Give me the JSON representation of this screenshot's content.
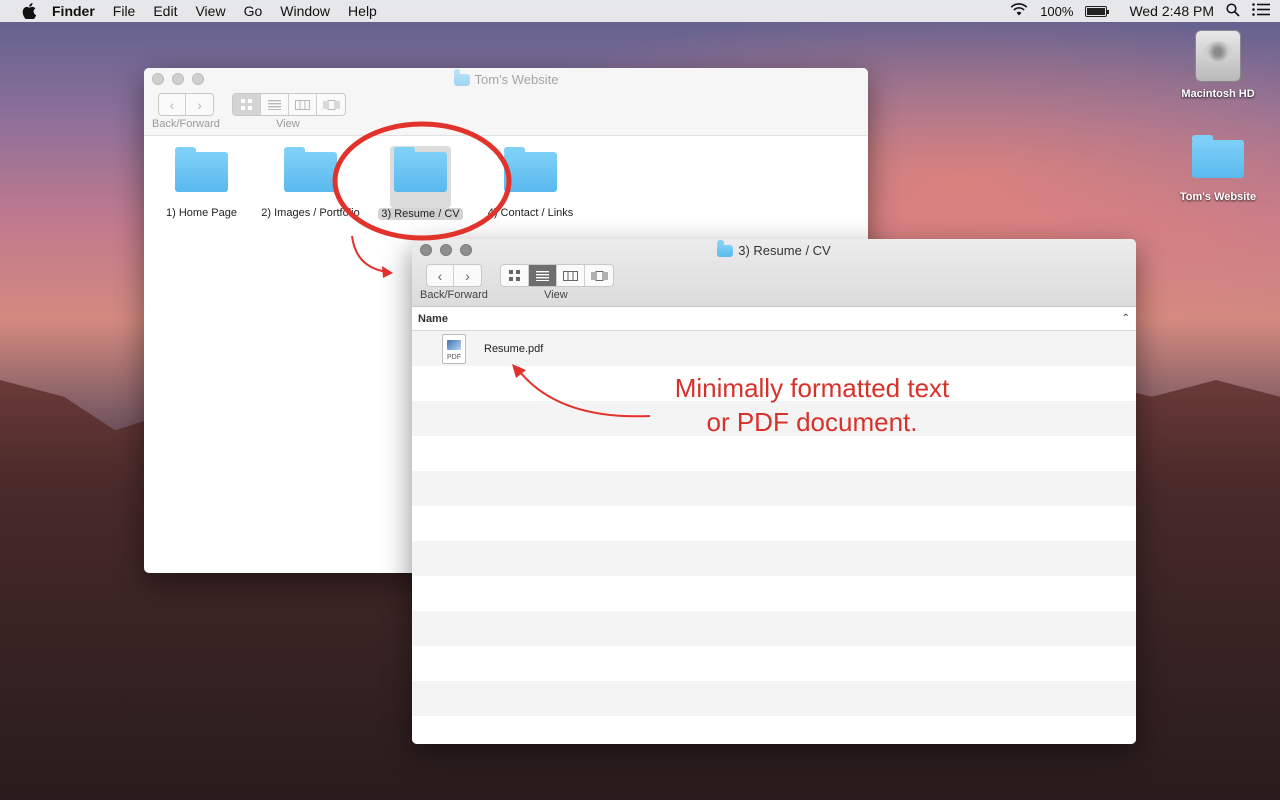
{
  "menubar": {
    "app_name": "Finder",
    "items": [
      "File",
      "Edit",
      "View",
      "Go",
      "Window",
      "Help"
    ],
    "battery_text": "100%",
    "battery_level": 1.0,
    "clock": "Wed 2:48 PM"
  },
  "desktop": {
    "icons": [
      {
        "label": "Macintosh HD",
        "icon": "hard-drive-icon"
      },
      {
        "label": "Tom's Website",
        "icon": "folder-icon"
      }
    ]
  },
  "window_back": {
    "title": "Tom's Website",
    "nav_label": "Back/Forward",
    "view_label": "View",
    "view_mode": "icon",
    "items": [
      {
        "label": "1) Home Page"
      },
      {
        "label": "2) Images / Portfolio"
      },
      {
        "label": "3) Resume / CV"
      },
      {
        "label": "4) Contact / Links"
      }
    ]
  },
  "window_front": {
    "title": "3) Resume / CV",
    "nav_label": "Back/Forward",
    "view_label": "View",
    "view_mode": "list",
    "column_header": "Name",
    "files": [
      {
        "name": "Resume.pdf",
        "type_badge": "PDF"
      }
    ]
  },
  "annotation": {
    "line1": "Minimally formatted text",
    "line2": "or PDF document.",
    "color": "#d6322a"
  }
}
